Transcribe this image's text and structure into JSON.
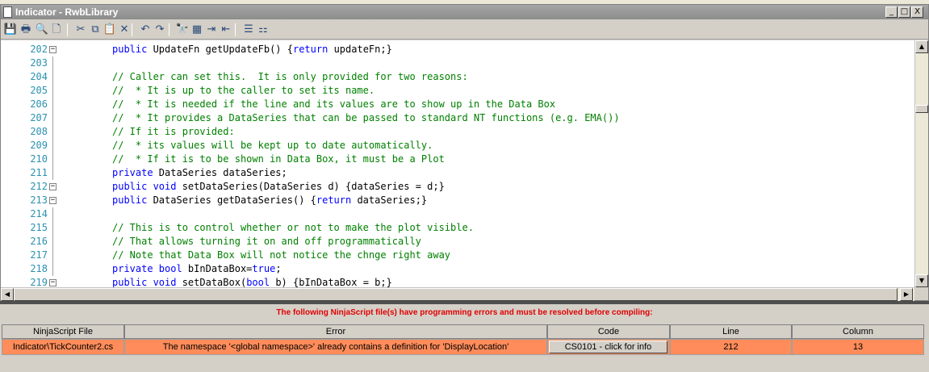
{
  "window": {
    "title": "Indicator - RwbLibrary",
    "controls": {
      "minimize": "_",
      "restore": "□",
      "close": "X"
    }
  },
  "toolbar": {
    "buttons": [
      {
        "icon": "save-icon",
        "glyph": "💾"
      },
      {
        "icon": "print-icon",
        "glyph": "🖶"
      },
      {
        "icon": "print-preview-icon",
        "glyph": "🔍"
      },
      {
        "icon": "page-setup-icon",
        "glyph": "🗋"
      },
      {
        "icon": "cut-icon",
        "glyph": "✂"
      },
      {
        "icon": "copy-icon",
        "glyph": "⧉"
      },
      {
        "icon": "paste-icon",
        "glyph": "📋"
      },
      {
        "icon": "delete-icon",
        "glyph": "✕"
      },
      {
        "icon": "undo-icon",
        "glyph": "↶"
      },
      {
        "icon": "redo-icon",
        "glyph": "↷"
      },
      {
        "icon": "find-icon",
        "glyph": "🔭"
      },
      {
        "icon": "replace-icon",
        "glyph": "▦"
      },
      {
        "icon": "indent-icon",
        "glyph": "⇥"
      },
      {
        "icon": "outdent-icon",
        "glyph": "⇤"
      },
      {
        "icon": "comment-icon",
        "glyph": "☰"
      },
      {
        "icon": "uncomment-icon",
        "glyph": "⚏"
      }
    ]
  },
  "editor": {
    "lines": [
      {
        "num": "202",
        "fold": "minus",
        "tokens": [
          {
            "t": "kw",
            "v": "public"
          },
          {
            "t": "tx",
            "v": " UpdateFn getUpdateFb() {"
          },
          {
            "t": "kw",
            "v": "return"
          },
          {
            "t": "tx",
            "v": " updateFn;}"
          }
        ]
      },
      {
        "num": "203",
        "fold": "",
        "tokens": []
      },
      {
        "num": "204",
        "fold": "",
        "tokens": [
          {
            "t": "cm",
            "v": "// Caller can set this.  It is only provided for two reasons:"
          }
        ]
      },
      {
        "num": "205",
        "fold": "",
        "tokens": [
          {
            "t": "cm",
            "v": "//  * It is up to the caller to set its name."
          }
        ]
      },
      {
        "num": "206",
        "fold": "",
        "tokens": [
          {
            "t": "cm",
            "v": "//  * It is needed if the line and its values are to show up in the Data Box"
          }
        ]
      },
      {
        "num": "207",
        "fold": "",
        "tokens": [
          {
            "t": "cm",
            "v": "//  * It provides a DataSeries that can be passed to standard NT functions (e.g. EMA())"
          }
        ]
      },
      {
        "num": "208",
        "fold": "",
        "tokens": [
          {
            "t": "cm",
            "v": "// If it is provided:"
          }
        ]
      },
      {
        "num": "209",
        "fold": "",
        "tokens": [
          {
            "t": "cm",
            "v": "//  * its values will be kept up to date automatically."
          }
        ]
      },
      {
        "num": "210",
        "fold": "",
        "tokens": [
          {
            "t": "cm",
            "v": "//  * If it is to be shown in Data Box, it must be a Plot"
          }
        ]
      },
      {
        "num": "211",
        "fold": "",
        "tokens": [
          {
            "t": "kw",
            "v": "private"
          },
          {
            "t": "tx",
            "v": " DataSeries dataSeries;"
          }
        ]
      },
      {
        "num": "212",
        "fold": "minus",
        "tokens": [
          {
            "t": "kw",
            "v": "public void"
          },
          {
            "t": "tx",
            "v": " setDataSeries(DataSeries d) {dataSeries = d;}"
          }
        ]
      },
      {
        "num": "213",
        "fold": "minus",
        "tokens": [
          {
            "t": "kw",
            "v": "public"
          },
          {
            "t": "tx",
            "v": " DataSeries getDataSeries() {"
          },
          {
            "t": "kw",
            "v": "return"
          },
          {
            "t": "tx",
            "v": " dataSeries;}"
          }
        ]
      },
      {
        "num": "214",
        "fold": "",
        "tokens": []
      },
      {
        "num": "215",
        "fold": "",
        "tokens": [
          {
            "t": "cm",
            "v": "// This is to control whether or not to make the plot visible."
          }
        ]
      },
      {
        "num": "216",
        "fold": "",
        "tokens": [
          {
            "t": "cm",
            "v": "// That allows turning it on and off programmatically"
          }
        ]
      },
      {
        "num": "217",
        "fold": "",
        "tokens": [
          {
            "t": "cm",
            "v": "// Note that Data Box will not notice the chnge right away"
          }
        ]
      },
      {
        "num": "218",
        "fold": "",
        "tokens": [
          {
            "t": "kw",
            "v": "private bool"
          },
          {
            "t": "tx",
            "v": " bInDataBox="
          },
          {
            "t": "kw",
            "v": "true"
          },
          {
            "t": "tx",
            "v": ";"
          }
        ]
      },
      {
        "num": "219",
        "fold": "minus",
        "tokens": [
          {
            "t": "kw",
            "v": "public void"
          },
          {
            "t": "tx",
            "v": " setDataBox("
          },
          {
            "t": "kw",
            "v": "bool"
          },
          {
            "t": "tx",
            "v": " b) {bInDataBox = b;}"
          }
        ]
      }
    ]
  },
  "scrollbars": {
    "up": "▲",
    "down": "▼",
    "left": "◀",
    "right": "▶"
  },
  "errors": {
    "heading": "The following NinjaScript file(s) have programming errors and must be resolved before compiling:",
    "columns": [
      "NinjaScript File",
      "Error",
      "Code",
      "Line",
      "Column"
    ],
    "rows": [
      {
        "file": "Indicator\\TickCounter2.cs",
        "error": "The namespace '<global namespace>' already contains a definition for 'DisplayLocation'",
        "code": "CS0101 - click for info",
        "line": "212",
        "column": "13"
      }
    ]
  },
  "colors": {
    "error_row": "#ff8c5a",
    "keyword": "#0000ff",
    "comment": "#008000",
    "line_number": "#2b91af",
    "heading": "#e00000"
  }
}
